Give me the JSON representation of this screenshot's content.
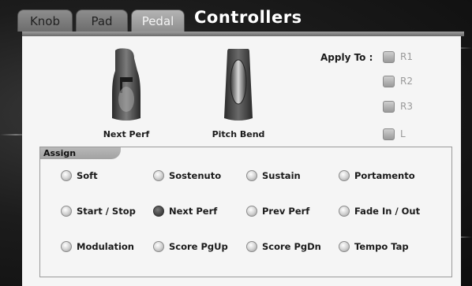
{
  "tabs": [
    {
      "label": "Knob",
      "active": false
    },
    {
      "label": "Pad",
      "active": false
    },
    {
      "label": "Pedal",
      "active": true
    }
  ],
  "title": "Controllers",
  "pedals": [
    {
      "label": "Next Perf",
      "icon": "sustain-pedal-icon"
    },
    {
      "label": "Pitch Bend",
      "icon": "expression-pedal-icon"
    }
  ],
  "apply_to": {
    "label": "Apply To :",
    "options": [
      {
        "label": "R1",
        "checked": false
      },
      {
        "label": "R2",
        "checked": false
      },
      {
        "label": "R3",
        "checked": false
      },
      {
        "label": "L",
        "checked": false
      }
    ]
  },
  "assign": {
    "title": "Assign",
    "rows": [
      [
        {
          "label": "Soft",
          "selected": false
        },
        {
          "label": "Sostenuto",
          "selected": false
        },
        {
          "label": "Sustain",
          "selected": false
        },
        {
          "label": "Portamento",
          "selected": false
        }
      ],
      [
        {
          "label": "Start / Stop",
          "selected": false
        },
        {
          "label": "Next Perf",
          "selected": true
        },
        {
          "label": "Prev Perf",
          "selected": false
        },
        {
          "label": "Fade In / Out",
          "selected": false
        }
      ],
      [
        {
          "label": "Modulation",
          "selected": false
        },
        {
          "label": "Score PgUp",
          "selected": false
        },
        {
          "label": "Score PgDn",
          "selected": false
        },
        {
          "label": "Tempo Tap",
          "selected": false
        }
      ]
    ]
  },
  "colors": {
    "panel_bg": "#f5f5f5",
    "selected_radio": "#4a4a4a",
    "disabled_text": "#9a9a9a"
  }
}
